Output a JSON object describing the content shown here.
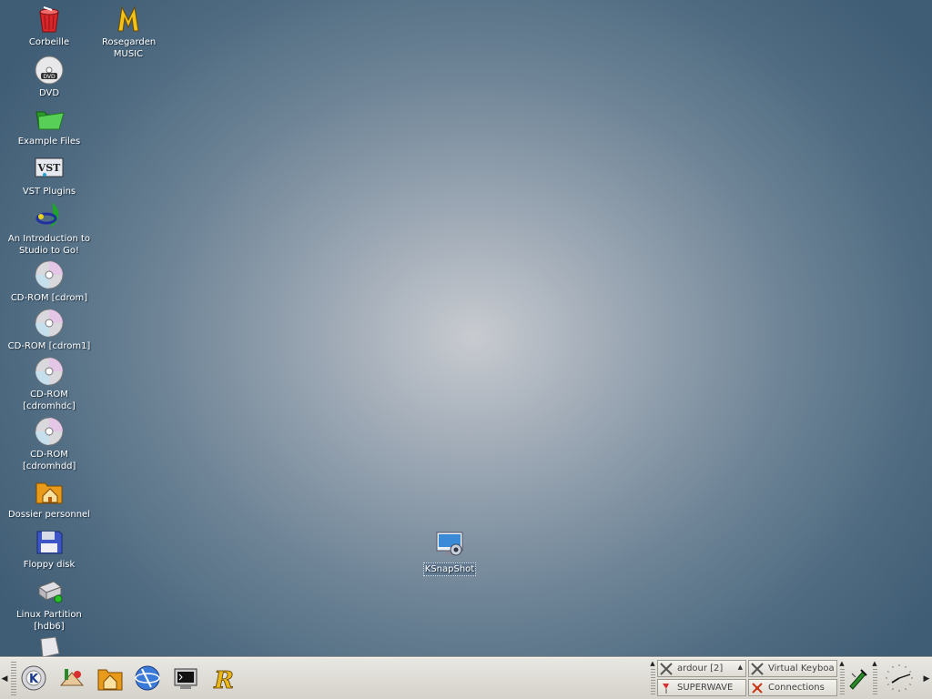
{
  "desktop": {
    "icons": [
      {
        "label": "Corbeille",
        "icon": "trash-icon"
      },
      {
        "label": "Rosegarden MUSIC",
        "icon": "rosegarden-icon"
      },
      {
        "label": "DVD",
        "icon": "dvd-icon"
      },
      {
        "label": "Example Files",
        "icon": "folder-icon"
      },
      {
        "label": "VST Plugins",
        "icon": "vst-icon"
      },
      {
        "label": "An Introduction to Studio to Go!",
        "icon": "studio-to-go-icon"
      },
      {
        "label": "CD-ROM [cdrom]",
        "icon": "cdrom-icon"
      },
      {
        "label": "CD-ROM [cdrom1]",
        "icon": "cdrom-icon"
      },
      {
        "label": "CD-ROM [cdromhdc]",
        "icon": "cdrom-icon"
      },
      {
        "label": "CD-ROM [cdromhdd]",
        "icon": "cdrom-icon"
      },
      {
        "label": "Dossier personnel",
        "icon": "home-folder-icon"
      },
      {
        "label": "Floppy disk",
        "icon": "floppy-icon"
      },
      {
        "label": "Linux Partition [hdb6]",
        "icon": "harddisk-icon"
      },
      {
        "label": "KSnapShot",
        "icon": "ksnapshot-icon"
      }
    ]
  },
  "taskbar": {
    "launchers": [
      "kde-menu-icon",
      "system-icon",
      "home-icon",
      "konqueror-icon",
      "terminal-icon",
      "rosegarden-icon"
    ],
    "tasks": [
      {
        "label": "ardour [2]",
        "icon": "x-app-icon"
      },
      {
        "label": "Virtual Keyboa",
        "icon": "x-app-icon"
      },
      {
        "label": "SUPERWAVE",
        "icon": "superwave-icon"
      },
      {
        "label": "Connections",
        "icon": "connections-icon"
      }
    ],
    "tray": [
      "pen-tool-icon",
      "clock-icon"
    ]
  }
}
